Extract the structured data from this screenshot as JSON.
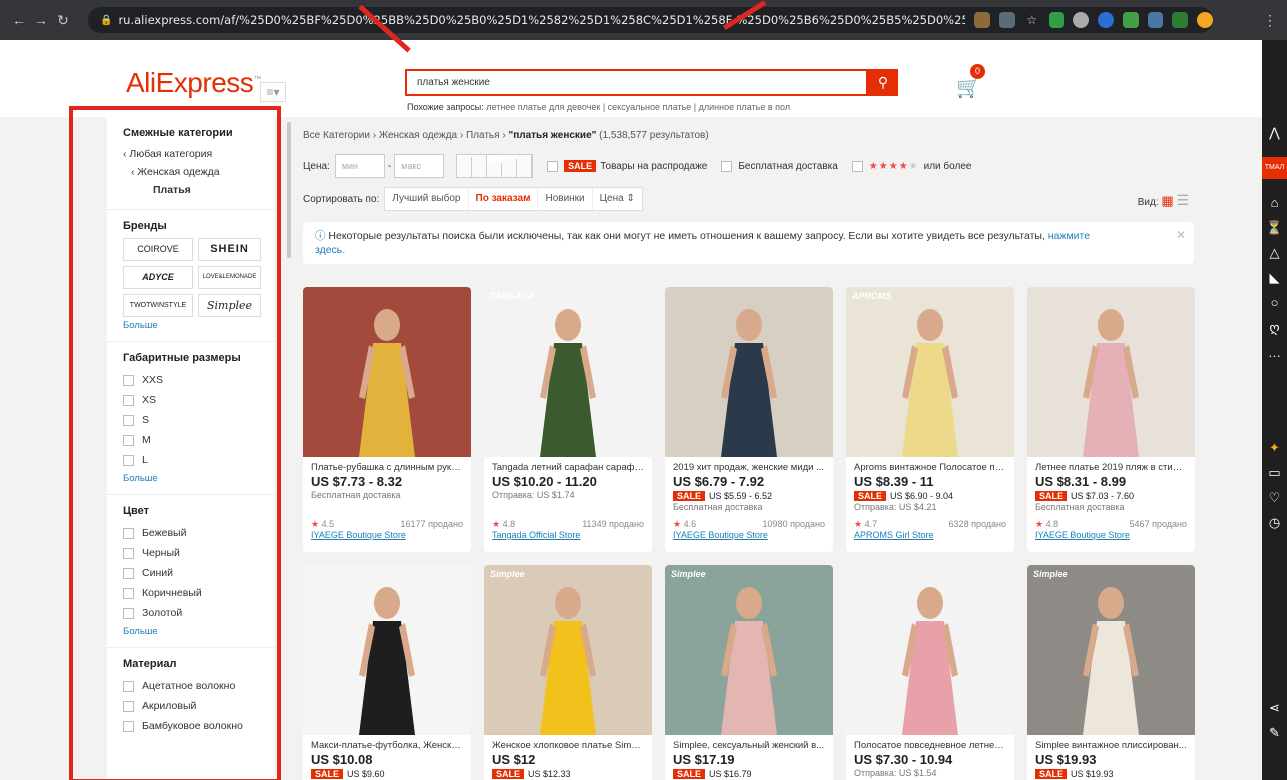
{
  "browser": {
    "url": "ru.aliexpress.com/af/%25D0%25BF%25D0%25BB%25D0%25B0%25D1%2582%25D1%258C%25D1%258F-%25D0%25B6%25D0%25B5%25D0%25BD%25D1%2581%25..."
  },
  "header": {
    "logo": "AliExpress",
    "search_value": "платья женские",
    "related_label": "Похожие запросы:",
    "related": [
      "летнее платье для девочек",
      "сексуальное платье",
      "длинное платье в пол"
    ],
    "cart_count": "0"
  },
  "sidebar": {
    "categories_title": "Смежные категории",
    "categories": [
      "Любая категория",
      "Женская одежда",
      "Платья"
    ],
    "brands_title": "Бренды",
    "brands": [
      "COIROVE",
      "SHEIN",
      "ADYCE",
      "LOVE&LEMONADE",
      "TWOTWINSTYLE",
      "Simplee"
    ],
    "more": "Больше",
    "sizes_title": "Габаритные размеры",
    "sizes": [
      "XXS",
      "XS",
      "S",
      "M",
      "L"
    ],
    "color_title": "Цвет",
    "colors": [
      "Бежевый",
      "Черный",
      "Синий",
      "Коричневый",
      "Золотой"
    ],
    "material_title": "Материал",
    "materials": [
      "Ацетатное волокно",
      "Акриловый",
      "Бамбуковое волокно"
    ]
  },
  "main": {
    "breadcrumb": {
      "all": "Все Категории",
      "women": "Женская одежда",
      "dresses": "Платья",
      "query": "\"платья женские\"",
      "count": "(1,538,577 результатов)"
    },
    "price": {
      "label": "Цена:",
      "min": "мин",
      "max": "макс",
      "sale_badge": "SALE",
      "sale_label": "Товары на распродаже",
      "free_shipping": "Бесплатная доставка",
      "stars": "★★★★",
      "rating_label": "или более"
    },
    "sort": {
      "label": "Сортировать по:",
      "options": [
        "Лучший выбор",
        "По заказам",
        "Новинки",
        "Цена ⇕"
      ],
      "view_label": "Вид:"
    },
    "notice": {
      "text": "Некоторые результаты поиска были исключены, так как они могут не иметь отношения к вашему запросу. Если вы хотите увидеть все результаты,",
      "link1": "нажмите",
      "link2": "здесь."
    }
  },
  "products": [
    {
      "title": "Платье-рубашка с длинным рука...",
      "price": "US $7.73 - 8.32",
      "sale": "",
      "ship": "Бесплатная доставка",
      "ship2": "",
      "rating": "4.5",
      "sold": "16177 продано",
      "store": "IYAEGE Boutique Store",
      "brandmark": "",
      "bg": "#a34a3c",
      "fg": "#e3b23c"
    },
    {
      "title": "Tangada летний сарафан сарафа...",
      "price": "US $10.20 - 11.20",
      "sale": "",
      "ship": "Отправка: US $1.74",
      "ship2": "",
      "rating": "4.8",
      "sold": "11349 продано",
      "store": "Tangada Official Store",
      "brandmark": "TANGADA",
      "bg": "#f3f3f3",
      "fg": "#3b5a2e"
    },
    {
      "title": "2019 хит продаж, женские миди ...",
      "price": "US $6.79 - 7.92",
      "sale": "US $5.59 - 6.52",
      "ship": "Бесплатная доставка",
      "ship2": "",
      "rating": "4.6",
      "sold": "10980 продано",
      "store": "IYAEGE Boutique Store",
      "brandmark": "",
      "bg": "#d8cfc4",
      "fg": "#2b3a4a"
    },
    {
      "title": "Aproms винтажное Полосатое пл...",
      "price": "US $8.39 - 11",
      "sale": "US $6.90 - 9.04",
      "ship": "Отправка: US $4.21",
      "ship2": "",
      "rating": "4.7",
      "sold": "6328 продано",
      "store": "APROMS Girl Store",
      "brandmark": "APROMS",
      "bg": "#e9e4d6",
      "fg": "#ecd98a"
    },
    {
      "title": "Летнее платье 2019 пляж в стиле...",
      "price": "US $8.31 - 8.99",
      "sale": "US $7.03 - 7.60",
      "ship": "Бесплатная доставка",
      "ship2": "",
      "rating": "4.8",
      "sold": "5467 продано",
      "store": "IYAEGE Boutique Store",
      "brandmark": "",
      "bg": "#e7e1d9",
      "fg": "#e5b1b6"
    },
    {
      "title": "Макси-платье-футболка, Женско...",
      "price": "US $10.08",
      "sale": "US $9.60",
      "ship": "",
      "ship2": "",
      "rating": "",
      "sold": "",
      "store": "",
      "brandmark": "",
      "bg": "#f5f5f5",
      "fg": "#1e1e1e"
    },
    {
      "title": "Женское хлопковое платье Simpl...",
      "price": "US $12",
      "sale": "US $12.33",
      "ship": "",
      "ship2": "",
      "rating": "",
      "sold": "",
      "store": "",
      "brandmark": "Simplee",
      "bg": "#d9cbb7",
      "fg": "#f1c21c"
    },
    {
      "title": "Simplee, сексуальный женский в...",
      "price": "US $17.19",
      "sale": "US $16.79",
      "ship": "",
      "ship2": "",
      "rating": "",
      "sold": "",
      "store": "",
      "brandmark": "Simplee",
      "bg": "#8aa39b",
      "fg": "#e3b6b1"
    },
    {
      "title": "Полосатое повседневное летнее...",
      "price": "US $7.30 - 10.94",
      "sale": "",
      "ship": "Отправка: US $1.54",
      "ship2": "",
      "rating": "",
      "sold": "",
      "store": "",
      "brandmark": "",
      "bg": "#f3f3f3",
      "fg": "#e9a1a9"
    },
    {
      "title": "Simplee винтажное плиссирован...",
      "price": "US $19.93",
      "sale": "US $19.93",
      "ship": "",
      "ship2": "",
      "rating": "",
      "sold": "",
      "store": "",
      "brandmark": "Simplee",
      "bg": "#8e8a86",
      "fg": "#ece7da"
    }
  ],
  "colors": {
    "accent": "#e62e04",
    "link": "#1a7eb8",
    "annotation": "#e0271f"
  }
}
